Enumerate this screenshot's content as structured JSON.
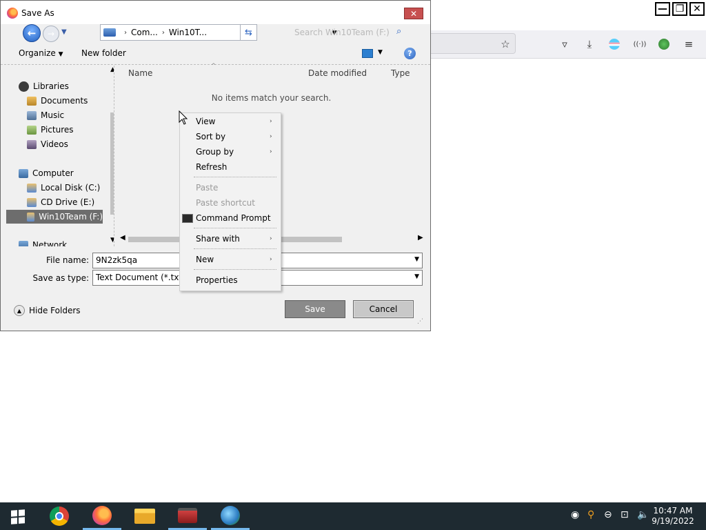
{
  "dialog": {
    "title": "Save As",
    "close_glyph": "✕",
    "address": {
      "crumbs": [
        "Com...",
        "Win10T..."
      ],
      "search_placeholder": "Search Win10Team (F:)"
    },
    "toolbar": {
      "organize": "Organize",
      "new_folder": "New folder",
      "help": "?"
    },
    "nav": {
      "items": [
        {
          "label": "Libraries",
          "icon": "libraries-icon"
        },
        {
          "label": "Documents",
          "icon": "documents-icon"
        },
        {
          "label": "Music",
          "icon": "music-icon"
        },
        {
          "label": "Pictures",
          "icon": "pictures-icon"
        },
        {
          "label": "Videos",
          "icon": "videos-icon"
        },
        {
          "label": "Computer",
          "icon": "computer-icon"
        },
        {
          "label": "Local Disk (C:)",
          "icon": "drive-icon"
        },
        {
          "label": "CD Drive (E:)",
          "icon": "cd-drive-icon"
        },
        {
          "label": "Win10Team (F:)",
          "icon": "drive-icon",
          "selected": true
        },
        {
          "label": "Network",
          "icon": "network-icon"
        }
      ]
    },
    "files": {
      "columns": [
        "Name",
        "Date modified",
        "Type"
      ],
      "empty_message": "No items match your search."
    },
    "filename_label": "File name:",
    "filename_value": "9N2zk5qa",
    "savetype_label": "Save as type:",
    "savetype_value": "Text Document (*.txt;*.text)",
    "hide_folders": "Hide Folders",
    "save_label": "Save",
    "cancel_label": "Cancel"
  },
  "context_menu": {
    "items": [
      {
        "label": "View",
        "submenu": true,
        "disabled": false
      },
      {
        "label": "Sort by",
        "submenu": true,
        "disabled": false
      },
      {
        "label": "Group by",
        "submenu": true,
        "disabled": false
      },
      {
        "label": "Refresh",
        "submenu": false,
        "disabled": false
      },
      {
        "label": "Paste",
        "submenu": false,
        "disabled": true
      },
      {
        "label": "Paste shortcut",
        "submenu": false,
        "disabled": true
      },
      {
        "label": "Command Prompt",
        "submenu": false,
        "disabled": false
      },
      {
        "label": "Share with",
        "submenu": true,
        "disabled": false
      },
      {
        "label": "New",
        "submenu": true,
        "disabled": false
      },
      {
        "label": "Properties",
        "submenu": false,
        "disabled": false
      }
    ]
  },
  "taskbar": {
    "time": "10:47 AM",
    "date": "9/19/2022",
    "apps": [
      "chrome-icon",
      "firefox-icon",
      "file-explorer-icon",
      "toolbox-icon",
      "idm-icon"
    ]
  },
  "colors": {
    "taskbar": "#1e2a31",
    "selected_nav": "#6d6d6d",
    "close_button": "#c75050"
  }
}
